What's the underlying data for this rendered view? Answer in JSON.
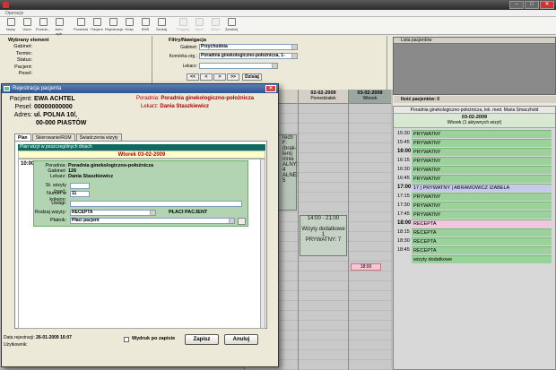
{
  "window": {
    "title": ""
  },
  "menu": {
    "label": "Operacje"
  },
  "toolbar": [
    {
      "name": "nowy",
      "label": "Nowy",
      "disabled": false
    },
    {
      "name": "usun",
      "label": "Usuń",
      "disabled": false
    },
    {
      "name": "porada",
      "label": "Porada...",
      "disabled": false
    },
    {
      "name": "auto",
      "label": "Auto. wyb.",
      "disabled": false
    },
    {
      "name": "poradnia",
      "label": "Poradnia",
      "disabled": false
    },
    {
      "name": "pacjent",
      "label": "Pacjent",
      "disabled": false
    },
    {
      "name": "rejestracja",
      "label": "Rejestracja",
      "disabled": false
    },
    {
      "name": "hosp",
      "label": "Hosp",
      "disabled": false
    },
    {
      "name": "sms",
      "label": "SMS",
      "disabled": false
    },
    {
      "name": "szukaj",
      "label": "Szukaj",
      "disabled": false
    },
    {
      "name": "przyjmij",
      "label": "Przyjmij",
      "disabled": true
    },
    {
      "name": "usun2",
      "label": "Usuń",
      "disabled": true
    },
    {
      "name": "zmien",
      "label": "Zmień",
      "disabled": true
    },
    {
      "name": "zamknij",
      "label": "Zamknij",
      "disabled": false
    }
  ],
  "selected_element": {
    "header": "Wybrany element",
    "fields": [
      {
        "label": "Gabinet:",
        "value": ""
      },
      {
        "label": "Termin:",
        "value": ""
      },
      {
        "label": "Status:",
        "value": ""
      },
      {
        "label": "Pacjent:",
        "value": ""
      },
      {
        "label": "Pesel:",
        "value": ""
      }
    ]
  },
  "filters": {
    "header": "Filtry/Nawigacja",
    "gabinet_label": "Gabinet:",
    "gabinet_value": "Przychodnia",
    "komorka_label": "Komórka org.:",
    "komorka_value": "Poradnia ginekologiczno-położnicza, 1-",
    "lekarz_label": "Lekarz:",
    "lekarz_value": "",
    "nav": [
      "<<",
      "<",
      ">",
      ">>"
    ],
    "today": "Dzisiaj"
  },
  "patient_list": {
    "header": "Lista pacjentów",
    "footer": "Ilość pacjentów: 0"
  },
  "schedule": {
    "col1_date": "",
    "col2_date": "02-02-2009",
    "col2_day": "Poniedziałek",
    "col3_date": "03-02-2009",
    "col3_day": "Wtorek",
    "slot1": "14:00 - 21:00",
    "slot1_desc": "Wizyty dodatkowe 1",
    "slot1_sub": "PRYWATNY: 7",
    "pink": "18:00",
    "side1_top": "rech",
    "side1_mid": "F: (brak-",
    "side1_mid2": "leni)",
    "side1_b": "nlnie",
    "side1_c": "ALNY: 4",
    "side1_d": "ALNE: 5"
  },
  "day_panel": {
    "doctor": "Poradnia ginekologiczno-położnicza, lek. med. Maria Smaczhold",
    "date": "03-02-2009",
    "info": "Wtorek (1 aktywnych wizyt)",
    "rows": [
      {
        "time": "15:30",
        "text": "PRYWATNY",
        "kind": "g",
        "big": false
      },
      {
        "time": "15:45",
        "text": "PRYWATNY",
        "kind": "g",
        "big": false
      },
      {
        "time": "16:00",
        "text": "PRYWATNY",
        "kind": "g",
        "big": true
      },
      {
        "time": "16:15",
        "text": "PRYWATNY",
        "kind": "g",
        "big": false
      },
      {
        "time": "16:30",
        "text": "PRYWATNY",
        "kind": "g",
        "big": false
      },
      {
        "time": "16:45",
        "text": "PRYWATNY",
        "kind": "g",
        "big": false
      },
      {
        "time": "17:00",
        "text": "17 | PRYWATNY | ABRAMOWICZ IZABELA",
        "kind": "l",
        "big": true
      },
      {
        "time": "17:15",
        "text": "PRYWATNY",
        "kind": "g",
        "big": false
      },
      {
        "time": "17:30",
        "text": "PRYWATNY",
        "kind": "g",
        "big": false
      },
      {
        "time": "17:45",
        "text": "PRYWATNY",
        "kind": "g",
        "big": false
      },
      {
        "time": "18:00",
        "text": "RECEPTA",
        "kind": "p",
        "big": true
      },
      {
        "time": "18:15",
        "text": "RECEPTA",
        "kind": "g",
        "big": false
      },
      {
        "time": "18:30",
        "text": "RECEPTA",
        "kind": "g",
        "big": false
      },
      {
        "time": "18:45",
        "text": "RECEPTA",
        "kind": "g",
        "big": false
      },
      {
        "time": "",
        "text": "wizyty dodatkowe",
        "kind": "g",
        "big": false
      }
    ]
  },
  "dialog": {
    "title": "Rejestracja pacjenta",
    "patient_label": "Pacjent:",
    "patient": "EWA ACHTEL",
    "pesel_label": "Pesel:",
    "pesel": "00000000000",
    "address_label": "Adres:",
    "address1": "ul. POLNA 10/,",
    "address2": "00-000 PIASTÓW",
    "poradnia_label": "Poradnia:",
    "poradnia": "Poradnia ginekologiczno-położnicza",
    "lekarz_label": "Lekarz:",
    "lekarz": "Dania Staszkiewicz",
    "tabs": [
      "Plan",
      "Skierowanie/RUM",
      "Świadczenia wizyty"
    ],
    "plan_header": "Plan wizyt w poszczególnych dniach",
    "plan_day": "Wtorek 03-02-2009",
    "plan_time": "10:00",
    "visit_poradnia_label": "Poradnia:",
    "visit_poradnia": "Poradnia ginekologiczno-położnicza",
    "visit_gabinet_label": "Gabinet:",
    "visit_gabinet": "126",
    "visit_lekarz_label": "Lekarz:",
    "visit_lekarz": "Dania Staszkiewicz",
    "st_label": "St. wizyty (nas):",
    "st_value": "",
    "numer_label": "Numer w kolejce:",
    "numer_value": "11",
    "uwagi_label": "Uwagi:",
    "uwagi_value": "",
    "rodzaj_label": "Rodzaj wizyty:",
    "rodzaj_value": "RECEPTA",
    "placi_label": "PŁACI PACJENT",
    "platnik_label": "Płatnik:",
    "platnik_value": "Płaci pacjent",
    "data_rej_label": "Data rejestracji:",
    "data_rej": "26-01-2009 16:07",
    "uzytkownik_label": "Użytkownik:",
    "uzytkownik": "",
    "wydruk_label": "Wydruk po zapisie",
    "zapisz": "Zapisz",
    "anuluj": "Anuluj"
  }
}
